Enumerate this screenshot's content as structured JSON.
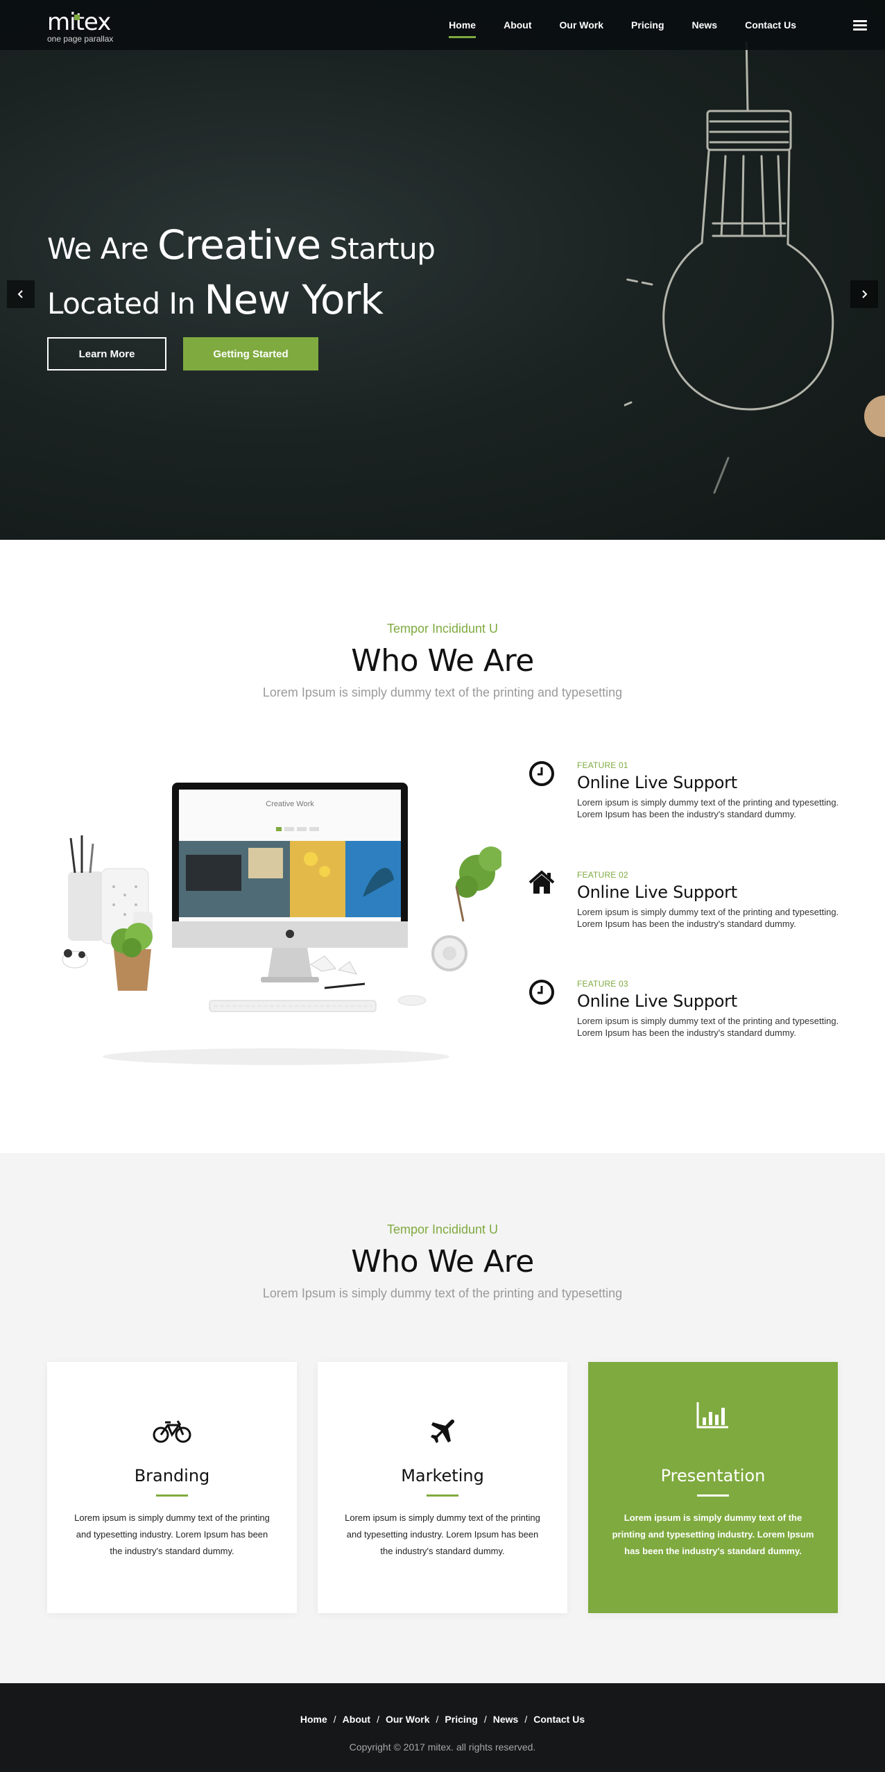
{
  "header": {
    "logo_text": "mitex",
    "logo_tagline": "one page parallax",
    "nav": [
      {
        "label": "Home",
        "active": true
      },
      {
        "label": "About",
        "active": false
      },
      {
        "label": "Our Work",
        "active": false
      },
      {
        "label": "Pricing",
        "active": false
      },
      {
        "label": "News",
        "active": false
      },
      {
        "label": "Contact Us",
        "active": false
      }
    ],
    "menu_icon": "hamburger-icon"
  },
  "hero": {
    "line1_small": "We Are ",
    "line1_big": "Creative",
    "line1_small_end": " Startup",
    "line2_small": "Located In ",
    "line2_big": "New York",
    "btn_learn_more": "Learn More",
    "btn_getting_started": "Getting Started",
    "prev_icon": "chevron-left-icon",
    "next_icon": "chevron-right-icon"
  },
  "about": {
    "eyebrow": "Tempor Incididunt U",
    "title": "Who We Are",
    "subtitle": "Lorem Ipsum is simply dummy text of the printing and typesetting",
    "features": [
      {
        "label": "FEATURE 01",
        "title": "Online Live Support",
        "desc": "Lorem ipsum is simply dummy text of the printing and typesetting. Lorem Ipsum has been the industry's standard dummy.",
        "icon": "clock-icon"
      },
      {
        "label": "FEATURE 02",
        "title": "Online Live Support",
        "desc": "Lorem ipsum is simply dummy text of the printing and typesetting. Lorem Ipsum has been the industry's standard dummy.",
        "icon": "home-icon"
      },
      {
        "label": "FEATURE 03",
        "title": "Online Live Support",
        "desc": "Lorem ipsum is simply dummy text of the printing and typesetting. Lorem Ipsum has been the industry's standard dummy.",
        "icon": "clock-icon"
      }
    ],
    "monitor_screen_title": "Creative Work"
  },
  "services": {
    "eyebrow": "Tempor Incididunt U",
    "title": "Who We Are",
    "subtitle": "Lorem Ipsum is simply dummy text of the printing and typesetting",
    "cards": [
      {
        "title": "Branding",
        "text": "Lorem ipsum is simply dummy text of the printing and typesetting industry. Lorem Ipsum has been the industry's standard dummy.",
        "icon": "bicycle-icon"
      },
      {
        "title": "Marketing",
        "text": "Lorem ipsum is simply dummy text of the printing and typesetting industry. Lorem Ipsum has been the industry's standard dummy.",
        "icon": "airplane-icon"
      },
      {
        "title": "Presentation",
        "text": "Lorem ipsum is simply dummy text of the printing and typesetting industry. Lorem Ipsum has been the industry's standard dummy.",
        "icon": "bar-chart-icon"
      }
    ]
  },
  "footer": {
    "links": [
      "Home",
      "About",
      "Our Work",
      "Pricing",
      "News",
      "Contact Us"
    ],
    "separator": "/",
    "copyright": "Copyright © 2017 mitex. all rights reserved."
  },
  "colors": {
    "accent": "#7faa3f",
    "header_bg": "#0a0e10",
    "hero_bg": "#1b2322",
    "services_bg": "#f4f4f4",
    "footer_bg": "#151719"
  }
}
